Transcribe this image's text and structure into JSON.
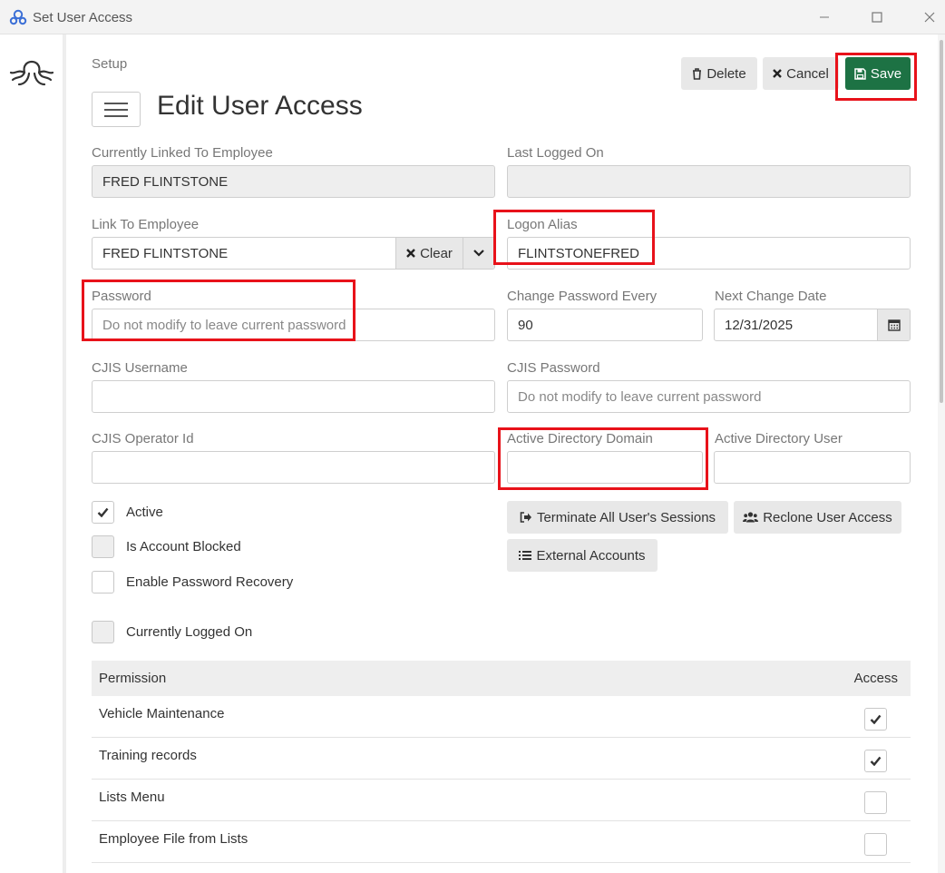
{
  "window": {
    "title": "Set User Access",
    "app_icon": "octopus-logo-icon",
    "controls": [
      "minimize-icon",
      "maximize-icon",
      "close-icon"
    ]
  },
  "breadcrumb": "Setup",
  "page_title": "Edit User Access",
  "toolbar": {
    "delete_label": "Delete",
    "cancel_label": "Cancel",
    "save_label": "Save"
  },
  "form": {
    "linked_employee": {
      "label": "Currently Linked To Employee",
      "value": "FRED FLINTSTONE"
    },
    "last_logged_on": {
      "label": "Last Logged On",
      "value": ""
    },
    "link_to_employee": {
      "label": "Link To Employee",
      "value": "FRED FLINTSTONE",
      "clear_label": "Clear"
    },
    "logon_alias": {
      "label": "Logon Alias",
      "value": "FLINTSTONEFRED"
    },
    "password": {
      "label": "Password",
      "placeholder": "Do not modify to leave current password"
    },
    "change_password_every": {
      "label": "Change Password Every",
      "value": "90"
    },
    "next_change_date": {
      "label": "Next Change Date",
      "value": "12/31/2025"
    },
    "cjis_username": {
      "label": "CJIS Username",
      "value": ""
    },
    "cjis_password": {
      "label": "CJIS Password",
      "placeholder": "Do not modify to leave current password"
    },
    "cjis_operator_id": {
      "label": "CJIS Operator Id",
      "value": ""
    },
    "ad_domain": {
      "label": "Active Directory Domain",
      "value": ""
    },
    "ad_user": {
      "label": "Active Directory User",
      "value": ""
    }
  },
  "checkboxes": {
    "active": {
      "label": "Active",
      "checked": true
    },
    "account_blocked": {
      "label": "Is Account Blocked",
      "checked": false
    },
    "password_recovery": {
      "label": "Enable Password Recovery",
      "checked": false
    },
    "logged_on": {
      "label": "Currently Logged On",
      "checked": false
    }
  },
  "actions": {
    "terminate_label": "Terminate All User's Sessions",
    "reclone_label": "Reclone User Access",
    "external_label": "External Accounts"
  },
  "permissions": {
    "col_permission": "Permission",
    "col_access": "Access",
    "rows": [
      {
        "name": "Vehicle Maintenance",
        "access": true
      },
      {
        "name": "Training records",
        "access": true
      },
      {
        "name": "Lists Menu",
        "access": false
      },
      {
        "name": "Employee File from Lists",
        "access": false
      }
    ]
  },
  "colors": {
    "save": "#1d7244",
    "highlight": "#e8121a",
    "readonly_bg": "#eeeeee"
  }
}
